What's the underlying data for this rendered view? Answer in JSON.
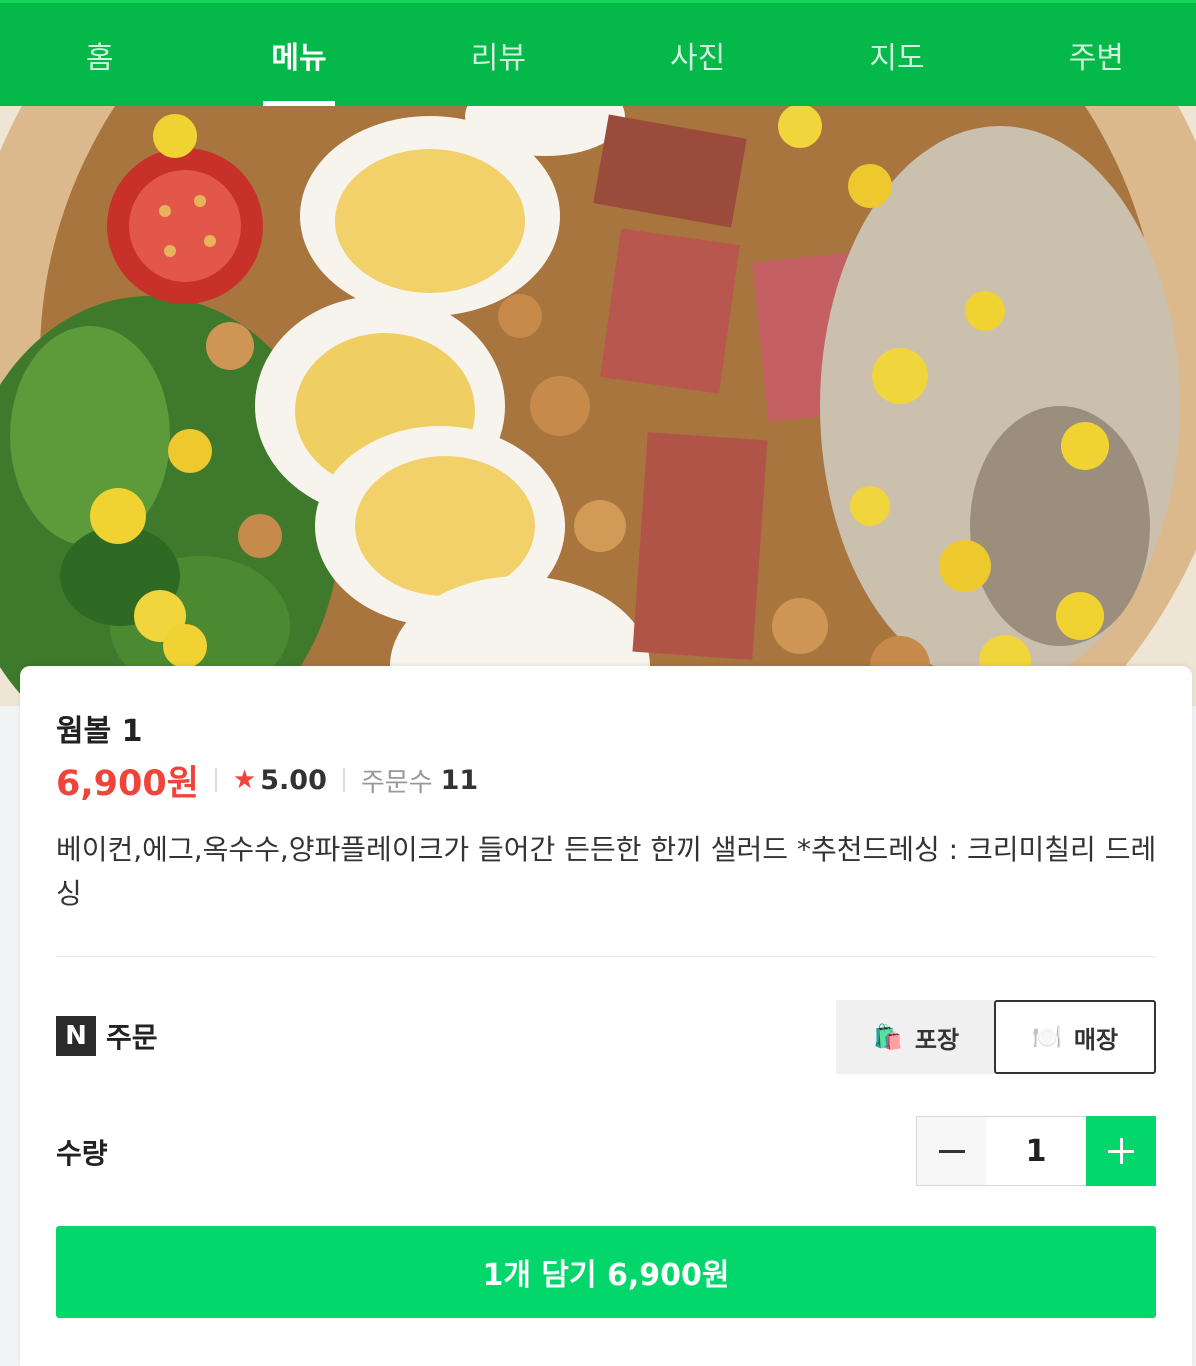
{
  "tabs": [
    {
      "label": "홈",
      "active": false
    },
    {
      "label": "메뉴",
      "active": true
    },
    {
      "label": "리뷰",
      "active": false
    },
    {
      "label": "사진",
      "active": false
    },
    {
      "label": "지도",
      "active": false
    },
    {
      "label": "주변",
      "active": false
    }
  ],
  "colors": {
    "brand_green": "#04b94a",
    "cta_green": "#03d66a",
    "price_red": "#f0433a"
  },
  "menu": {
    "name": "웜볼 1",
    "price": "6,900원",
    "rating": "5.00",
    "orders_label": "주문수",
    "orders_count": "11",
    "description": "베이컨,에그,옥수수,양파플레이크가 들어간 든든한 한끼 샐러드 *추천드레싱 : 크리미칠리 드레싱"
  },
  "order": {
    "logo_letter": "N",
    "label": "주문",
    "options": [
      {
        "label": "포장",
        "icon": "shopping-bag-icon",
        "selected": false
      },
      {
        "label": "매장",
        "icon": "dining-plate-icon",
        "selected": true
      }
    ]
  },
  "quantity": {
    "label": "수량",
    "value": "1"
  },
  "cta": {
    "label": "1개 담기 6,900원"
  }
}
